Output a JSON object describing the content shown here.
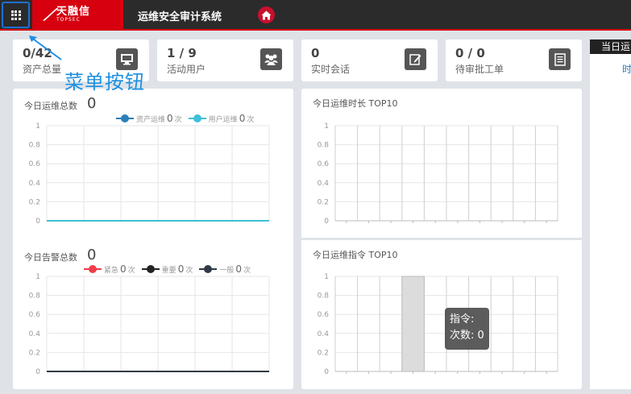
{
  "topbar": {
    "logo_cn": "天融信",
    "logo_en": "TOPSEC",
    "title": "运维安全审计系统"
  },
  "cards": [
    {
      "value": "0/42",
      "label": "资产总量",
      "icon": "monitor-icon"
    },
    {
      "value": "1 / 9",
      "label": "活动用户",
      "icon": "users-icon"
    },
    {
      "value": "0",
      "label": "实时会话",
      "icon": "edit-icon"
    },
    {
      "value": "0 / 0",
      "label": "待审批工单",
      "icon": "document-icon"
    }
  ],
  "right_panel": {
    "title": "当日运",
    "sub": "时"
  },
  "annotation": "菜单按钮",
  "panels": {
    "ops_total": {
      "title": "今日运维总数",
      "count": "0",
      "legend": [
        {
          "label": "资产运维",
          "value": "0",
          "unit": "次",
          "color": "#2b7fb8"
        },
        {
          "label": "用户运维",
          "value": "0",
          "unit": "次",
          "color": "#3ebfd8"
        }
      ]
    },
    "alerts_total": {
      "title": "今日告警总数",
      "count": "0",
      "legend": [
        {
          "label": "紧急",
          "value": "0",
          "unit": "次",
          "color": "#f03e4a"
        },
        {
          "label": "重要",
          "value": "0",
          "unit": "次",
          "color": "#222222"
        },
        {
          "label": "一般",
          "value": "0",
          "unit": "次",
          "color": "#2f3a44"
        }
      ]
    },
    "duration_top": {
      "title": "今日运维时长 TOP10"
    },
    "command_top": {
      "title": "今日运维指令 TOP10"
    }
  },
  "tooltip": {
    "line1": "指令:",
    "line2": "次数: 0"
  },
  "chart_data": [
    {
      "type": "line",
      "title": "今日运维总数",
      "ylim": [
        0,
        1
      ],
      "yticks": [
        "0",
        "0.2",
        "0.4",
        "0.6",
        "0.8",
        "1"
      ],
      "series": [
        {
          "name": "资产运维",
          "values": [
            0,
            0,
            0,
            0,
            0,
            0
          ],
          "color": "#2b7fb8"
        },
        {
          "name": "用户运维",
          "values": [
            0,
            0,
            0,
            0,
            0,
            0
          ],
          "color": "#3ebfd8"
        }
      ]
    },
    {
      "type": "line",
      "title": "今日告警总数",
      "ylim": [
        0,
        1
      ],
      "yticks": [
        "0",
        "0.2",
        "0.4",
        "0.6",
        "0.8",
        "1"
      ],
      "series": [
        {
          "name": "紧急",
          "values": [
            0,
            0,
            0,
            0,
            0,
            0
          ],
          "color": "#f03e4a"
        },
        {
          "name": "重要",
          "values": [
            0,
            0,
            0,
            0,
            0,
            0
          ],
          "color": "#222222"
        },
        {
          "name": "一般",
          "values": [
            0,
            0,
            0,
            0,
            0,
            0
          ],
          "color": "#2f3a44"
        }
      ]
    },
    {
      "type": "bar",
      "title": "今日运维时长 TOP10",
      "ylim": [
        0,
        1
      ],
      "yticks": [
        "0",
        "0.2",
        "0.4",
        "0.6",
        "0.8",
        "1"
      ],
      "values": [
        0,
        0,
        0,
        0,
        0,
        0,
        0,
        0,
        0,
        0
      ]
    },
    {
      "type": "bar",
      "title": "今日运维指令 TOP10",
      "ylim": [
        0,
        1
      ],
      "yticks": [
        "0",
        "0.2",
        "0.4",
        "0.6",
        "0.8",
        "1"
      ],
      "values": [
        0,
        0,
        0,
        0,
        0,
        0,
        0,
        0,
        0,
        0
      ],
      "highlight_index": 3
    }
  ]
}
